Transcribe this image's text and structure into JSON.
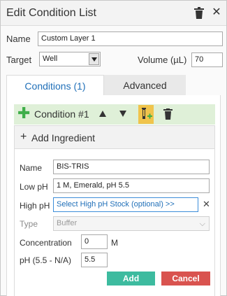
{
  "dialog": {
    "title": "Edit Condition List"
  },
  "form": {
    "name_label": "Name",
    "name_value": "Custom Layer 1",
    "target_label": "Target",
    "target_value": "Well",
    "volume_label": "Volume (µL)",
    "volume_value": "70"
  },
  "tabs": [
    {
      "label": "Conditions (1)",
      "active": true
    },
    {
      "label": "Advanced",
      "active": false
    }
  ],
  "condition": {
    "name": "Condition #1"
  },
  "ingredient": {
    "header": "Add Ingredient",
    "name_label": "Name",
    "name_value": "BIS-TRIS",
    "low_ph_label": "Low pH",
    "low_ph_value": "1 M, Emerald, pH 5.5",
    "high_ph_label": "High pH",
    "high_ph_value": "Select High pH Stock (optional) >>",
    "type_label": "Type",
    "type_value": "Buffer",
    "concentration_label": "Concentration",
    "concentration_value": "0",
    "concentration_unit": "M",
    "ph_label": "pH (5.5 - N/A)",
    "ph_value": "5.5",
    "add_label": "Add",
    "cancel_label": "Cancel"
  },
  "icons": {
    "trash": "trash-icon",
    "close": "close-icon",
    "add": "plus-icon",
    "move_up": "triangle-up-icon",
    "move_down": "triangle-down-icon",
    "add_ingredient": "tube-plus-icon",
    "clear": "x-icon"
  },
  "colors": {
    "accent": "#1f6fb8",
    "condition_bar": "#dff0d8",
    "plus_green": "#3fae49",
    "tube_yellow": "#f0c44c",
    "add_button": "#3dbb9f",
    "cancel_button": "#d9534f"
  }
}
